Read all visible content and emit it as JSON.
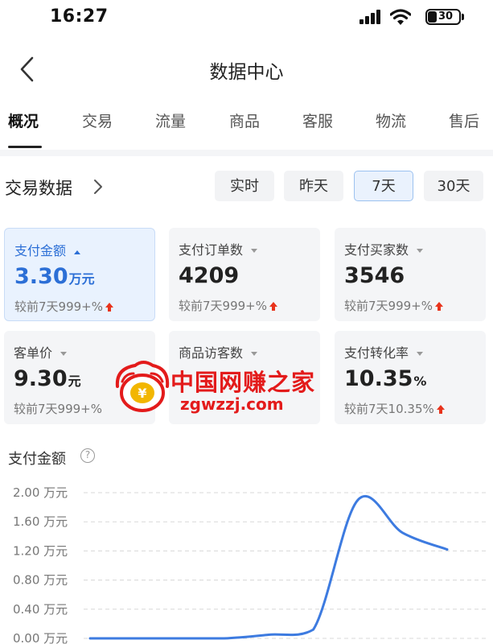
{
  "status_bar": {
    "time": "16:27",
    "battery": "30"
  },
  "nav": {
    "title": "数据中心"
  },
  "tabs": [
    {
      "label": "概况",
      "active": true
    },
    {
      "label": "交易",
      "active": false
    },
    {
      "label": "流量",
      "active": false
    },
    {
      "label": "商品",
      "active": false
    },
    {
      "label": "客服",
      "active": false
    },
    {
      "label": "物流",
      "active": false
    },
    {
      "label": "售后",
      "active": false
    }
  ],
  "section": {
    "title": "交易数据",
    "ranges": [
      {
        "label": "实时",
        "active": false
      },
      {
        "label": "昨天",
        "active": false
      },
      {
        "label": "7天",
        "active": true
      },
      {
        "label": "30天",
        "active": false
      }
    ]
  },
  "cards": [
    {
      "label": "支付金额",
      "value": "3.30",
      "unit": "万元",
      "compare": "较前7天999+%",
      "selected": true
    },
    {
      "label": "支付订单数",
      "value": "4209",
      "unit": "",
      "compare": "较前7天999+%",
      "selected": false
    },
    {
      "label": "支付买家数",
      "value": "3546",
      "unit": "",
      "compare": "较前7天999+%",
      "selected": false
    },
    {
      "label": "客单价",
      "value": "9.30",
      "unit": "元",
      "compare": "较前7天999+%",
      "selected": false
    },
    {
      "label": "商品访客数",
      "value": "",
      "unit": "",
      "compare": "",
      "selected": false
    },
    {
      "label": "支付转化率",
      "value": "10.35",
      "unit": "%",
      "compare": "较前7天10.35%",
      "selected": false
    }
  ],
  "watermark": {
    "text": "中国网赚之家",
    "url": "zgwzzj.com"
  },
  "chart_section": {
    "title": "支付金额",
    "help": "?"
  },
  "colors": {
    "accent": "#2c6fd6",
    "up": "#e8331c",
    "line": "#3d7be0",
    "card_bg": "#f4f5f7"
  },
  "chart_data": {
    "type": "line",
    "ylabel_unit": "万元",
    "y_ticks": [
      "2.00 万元",
      "1.60 万元",
      "1.20 万元",
      "0.80 万元",
      "0.40 万元",
      "0.00 万元"
    ],
    "ylim": [
      0,
      2.0
    ],
    "grid": true,
    "series": [
      {
        "values": [
          0.0,
          0.0,
          0.0,
          0.0,
          0.05,
          0.12,
          1.9,
          1.45,
          1.22
        ]
      }
    ]
  }
}
